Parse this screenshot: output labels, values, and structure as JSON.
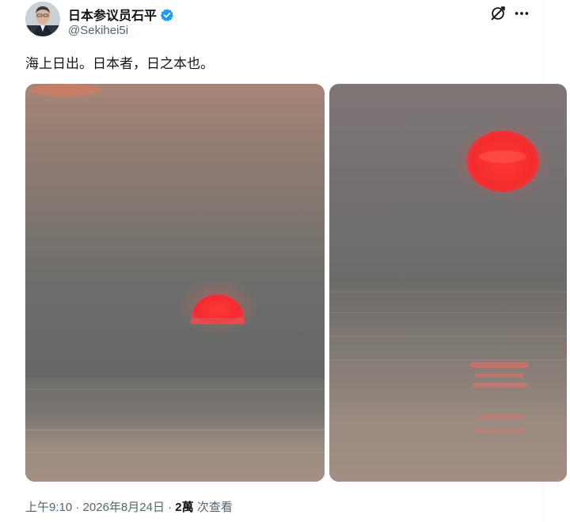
{
  "author": {
    "display_name": "日本参议员石平",
    "handle": "@Sekihei5i",
    "verified": true
  },
  "tweet": {
    "text": "海上日出。日本者，日之本也。"
  },
  "media": [
    {
      "subject": "sun rising over sea"
    },
    {
      "subject": "sun and reflection over sea"
    }
  ],
  "meta": {
    "time": "上午9:10",
    "separator": "·",
    "date": "2026年8月24日",
    "views_count": "2萬",
    "views_label": "次查看"
  },
  "icons": {
    "verified": "verified-badge-icon",
    "grok": "grok-icon",
    "more": "more-icon"
  },
  "colors": {
    "verified_blue": "#1d9bf0",
    "secondary_text": "#536471",
    "primary_text": "#0f1419"
  }
}
